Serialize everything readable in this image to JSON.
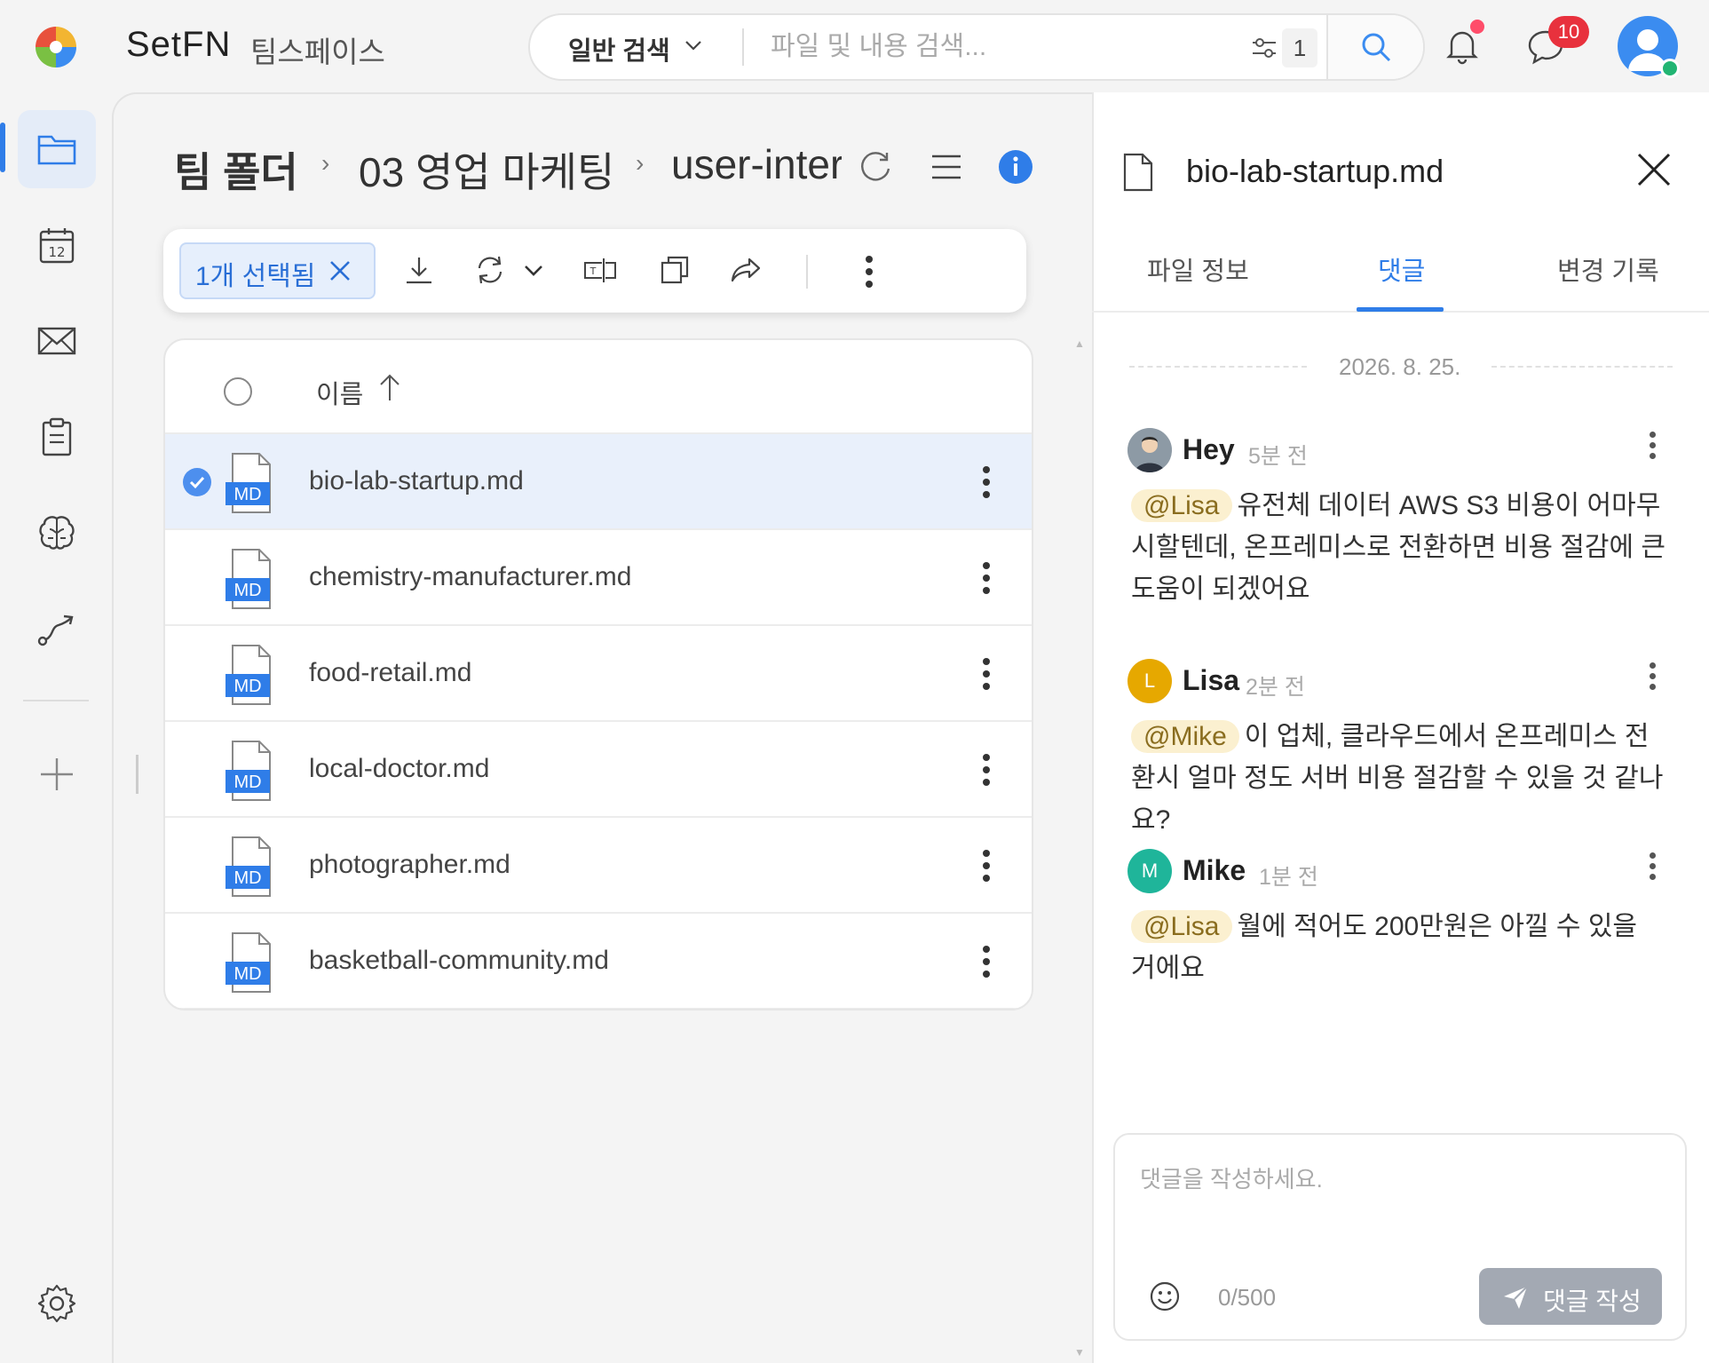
{
  "app": {
    "brand": "SetFN",
    "workspace": "팀스페이스"
  },
  "search": {
    "mode": "일반 검색",
    "placeholder": "파일 및 내용 검색...",
    "filter_count": "1"
  },
  "notifications": {
    "chat_badge": "10"
  },
  "breadcrumb": {
    "root": "팀 폴더",
    "folder": "03 영업 마케팅",
    "current": "user-inter"
  },
  "toolbar": {
    "selection_label": "1개 선택됨"
  },
  "file_list": {
    "header_name": "이름",
    "icon_label": "MD",
    "rows": [
      {
        "name": "bio-lab-startup.md",
        "selected": true
      },
      {
        "name": "chemistry-manufacturer.md",
        "selected": false
      },
      {
        "name": "food-retail.md",
        "selected": false
      },
      {
        "name": "local-doctor.md",
        "selected": false
      },
      {
        "name": "photographer.md",
        "selected": false
      },
      {
        "name": "basketball-community.md",
        "selected": false
      }
    ]
  },
  "panel": {
    "file_name": "bio-lab-startup.md",
    "tabs": [
      "파일 정보",
      "댓글",
      "변경 기록"
    ],
    "active_tab": "댓글",
    "date": "2026. 8. 25.",
    "comments": [
      {
        "author": "Hey",
        "time": "5분 전",
        "mention": "@Lisa",
        "text": "유전체 데이터 AWS S3 비용이 어마무시할텐데, 온프레미스로 전환하면 비용 절감에 큰 도움이 되겠어요"
      },
      {
        "author": "Lisa",
        "initial": "L",
        "color": "#e6a800",
        "time": "2분 전",
        "mention": "@Mike",
        "text": "이 업체, 클라우드에서 온프레미스 전환시 얼마 정도 서버 비용 절감할 수 있을 것 같나요?"
      },
      {
        "author": "Mike",
        "initial": "M",
        "color": "#1fb59a",
        "time": "1분 전",
        "mention": "@Lisa",
        "text": "월에 적어도 200만원은 아낄 수 있을 거에요"
      }
    ],
    "composer": {
      "placeholder": "댓글을 작성하세요.",
      "char_count": "0/500",
      "submit_label": "댓글 작성"
    }
  },
  "colors": {
    "accent": "#2f7de8",
    "badge": "#e8313d",
    "online": "#22b573",
    "selected_row": "#e9f0fb"
  }
}
